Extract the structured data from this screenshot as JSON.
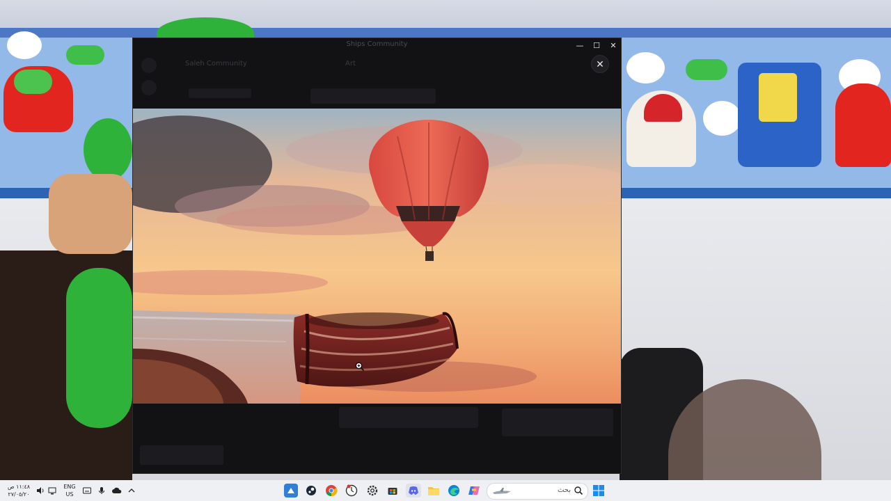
{
  "window": {
    "title": "Ships Community",
    "minimize_label": "—",
    "maximize_label": "☐",
    "close_label": "✕",
    "viewer_close_label": "✕"
  },
  "dimmed_ui": {
    "server_name": "Saleh Community",
    "channel_name": "Art"
  },
  "taskbar": {
    "clock_time": "١١:٤٨ ص",
    "clock_date": "٢٧/٠٥/٢٠",
    "lang_line1": "ENG",
    "lang_line2": "US",
    "search_placeholder": "بحث",
    "apps": [
      "whiteboard-app",
      "steam",
      "chrome",
      "clock-app",
      "settings",
      "store",
      "discord",
      "file-explorer",
      "edge",
      "copilot"
    ]
  }
}
